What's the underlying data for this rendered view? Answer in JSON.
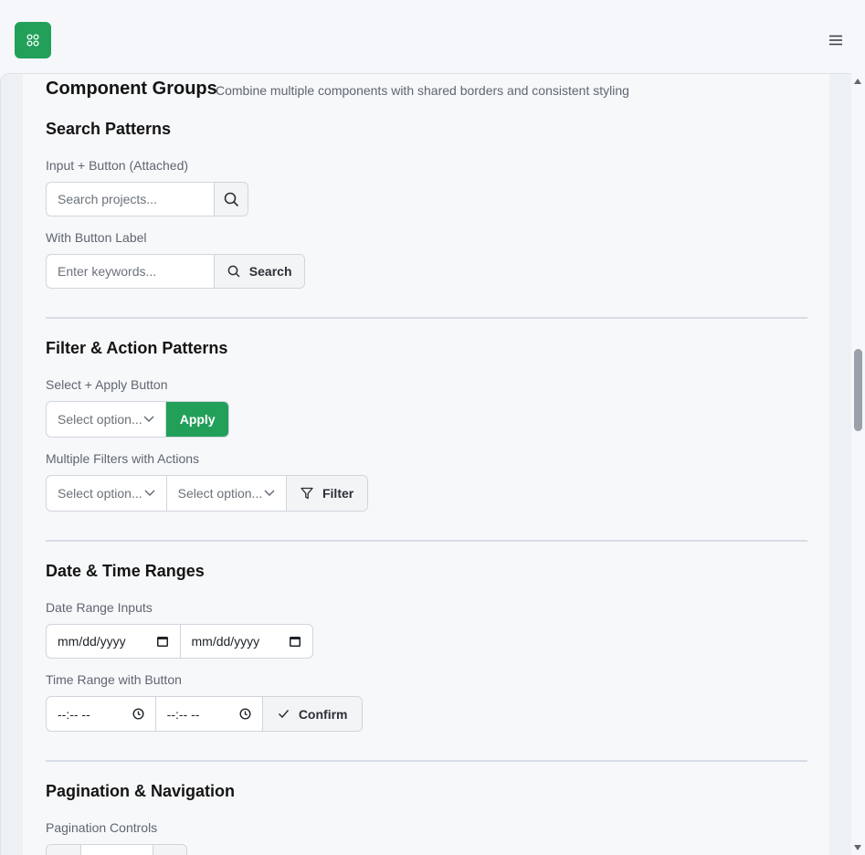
{
  "header": {
    "logo_icon": "grid-icon",
    "menu_icon": "hamburger-icon",
    "brand_color": "#22a05a"
  },
  "page": {
    "title": "Component Groups",
    "subtitle": "Combine multiple components with shared borders and consistent styling"
  },
  "search": {
    "title": "Search Patterns",
    "attached_label": "Input + Button (Attached)",
    "attached_placeholder": "Search projects...",
    "button_label_label": "With Button Label",
    "keywords_placeholder": "Enter keywords...",
    "search_button": "Search"
  },
  "filters": {
    "title": "Filter & Action Patterns",
    "select_apply_label": "Select + Apply Button",
    "select_placeholder": "Select option...",
    "apply_button": "Apply",
    "multi_label": "Multiple Filters with Actions",
    "filter_button": "Filter"
  },
  "dates": {
    "title": "Date & Time Ranges",
    "date_label": "Date Range Inputs",
    "date_value": "mm/dd/yyyy",
    "time_label": "Time Range with Button",
    "time_value": "--:-- --",
    "confirm_button": "Confirm"
  },
  "pagination": {
    "title": "Pagination & Navigation",
    "controls_label": "Pagination Controls"
  }
}
